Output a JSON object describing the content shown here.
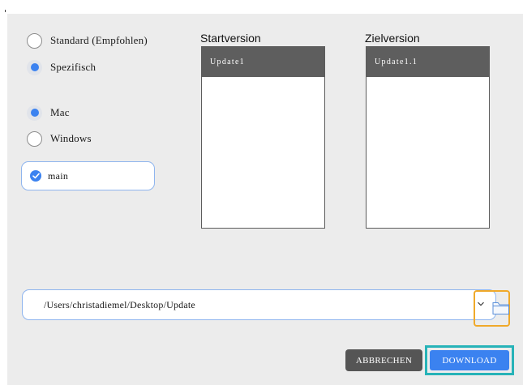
{
  "mode": {
    "options": [
      {
        "label": "Standard (Empfohlen)",
        "checked": false
      },
      {
        "label": "Spezifisch",
        "checked": true
      }
    ]
  },
  "platform": {
    "options": [
      {
        "label": "Mac",
        "checked": true
      },
      {
        "label": "Windows",
        "checked": false
      }
    ]
  },
  "branch": {
    "label": "main",
    "checked": true
  },
  "start_version": {
    "title": "Startversion",
    "selected": "Update1"
  },
  "target_version": {
    "title": "Zielversion",
    "selected": "Update1.1"
  },
  "path_field": {
    "value": "/Users/christadiemel/Desktop/Update"
  },
  "buttons": {
    "cancel": "ABBRECHEN",
    "download": "DOWNLOAD"
  },
  "colors": {
    "accent": "#3b82f0",
    "dialog_bg": "#ececec",
    "header_dark": "#5e5e5e",
    "cancel_bg": "#555555",
    "focus_orange": "#f0a92a",
    "focus_teal": "#27b3b8"
  },
  "icons": {
    "folder": "folder-icon",
    "chevron": "chevron-down-icon",
    "check": "checkmark-icon"
  }
}
